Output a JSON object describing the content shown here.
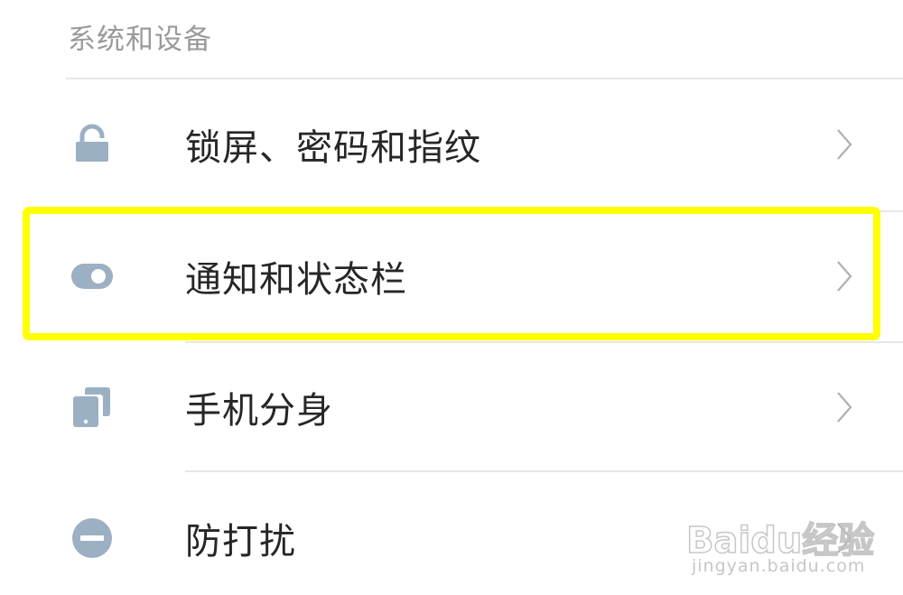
{
  "section": {
    "title": "系统和设备"
  },
  "rows": [
    {
      "label": "锁屏、密码和指纹",
      "icon": "lock-icon"
    },
    {
      "label": "通知和状态栏",
      "icon": "toggle-icon"
    },
    {
      "label": "手机分身",
      "icon": "phone-clone-icon"
    },
    {
      "label": "防打扰",
      "icon": "do-not-disturb-icon"
    }
  ],
  "highlight": {
    "target": "通知和状态栏",
    "color": "#ffff00"
  },
  "colors": {
    "icon": "#9bb0c3",
    "chevron": "#b0b0b0",
    "text": "#262626",
    "header": "#9a9a9a"
  },
  "watermark": {
    "brand": "Baidu经验",
    "url": "jingyan.baidu.com"
  }
}
